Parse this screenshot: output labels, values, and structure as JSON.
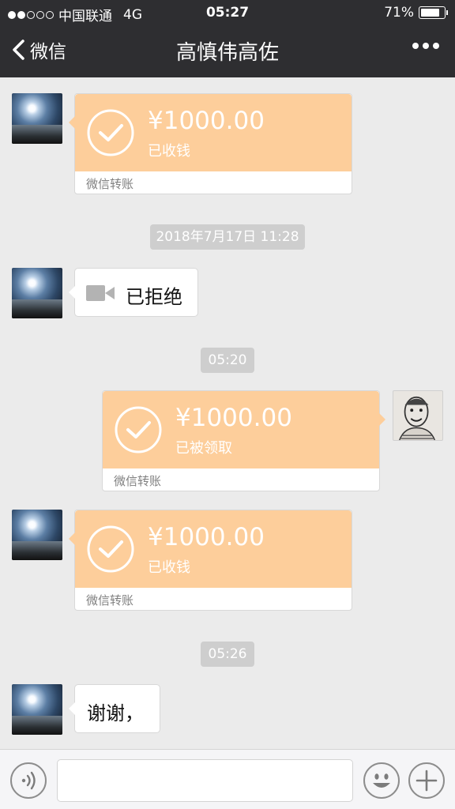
{
  "status_bar": {
    "carrier": "中国联通",
    "network": "4G",
    "time": "05:27",
    "battery": "71%"
  },
  "nav": {
    "back_label": "微信",
    "title": "高慎伟高佐"
  },
  "messages": {
    "transfer_1": {
      "amount": "¥1000.00",
      "status": "已收钱",
      "label": "微信转账"
    },
    "timestamp_1": "2018年7月17日 11:28",
    "video_call": {
      "text": "已拒绝"
    },
    "timestamp_2": "05:20",
    "transfer_2": {
      "amount": "¥1000.00",
      "status": "已被领取",
      "label": "微信转账"
    },
    "transfer_3": {
      "amount": "¥1000.00",
      "status": "已收钱",
      "label": "微信转账"
    },
    "timestamp_3": "05:26",
    "text_1": {
      "text": "谢谢，"
    }
  },
  "colors": {
    "nav_bg": "#2e2e31",
    "chat_bg": "#ebebeb",
    "transfer_orange": "#fdce9b"
  }
}
